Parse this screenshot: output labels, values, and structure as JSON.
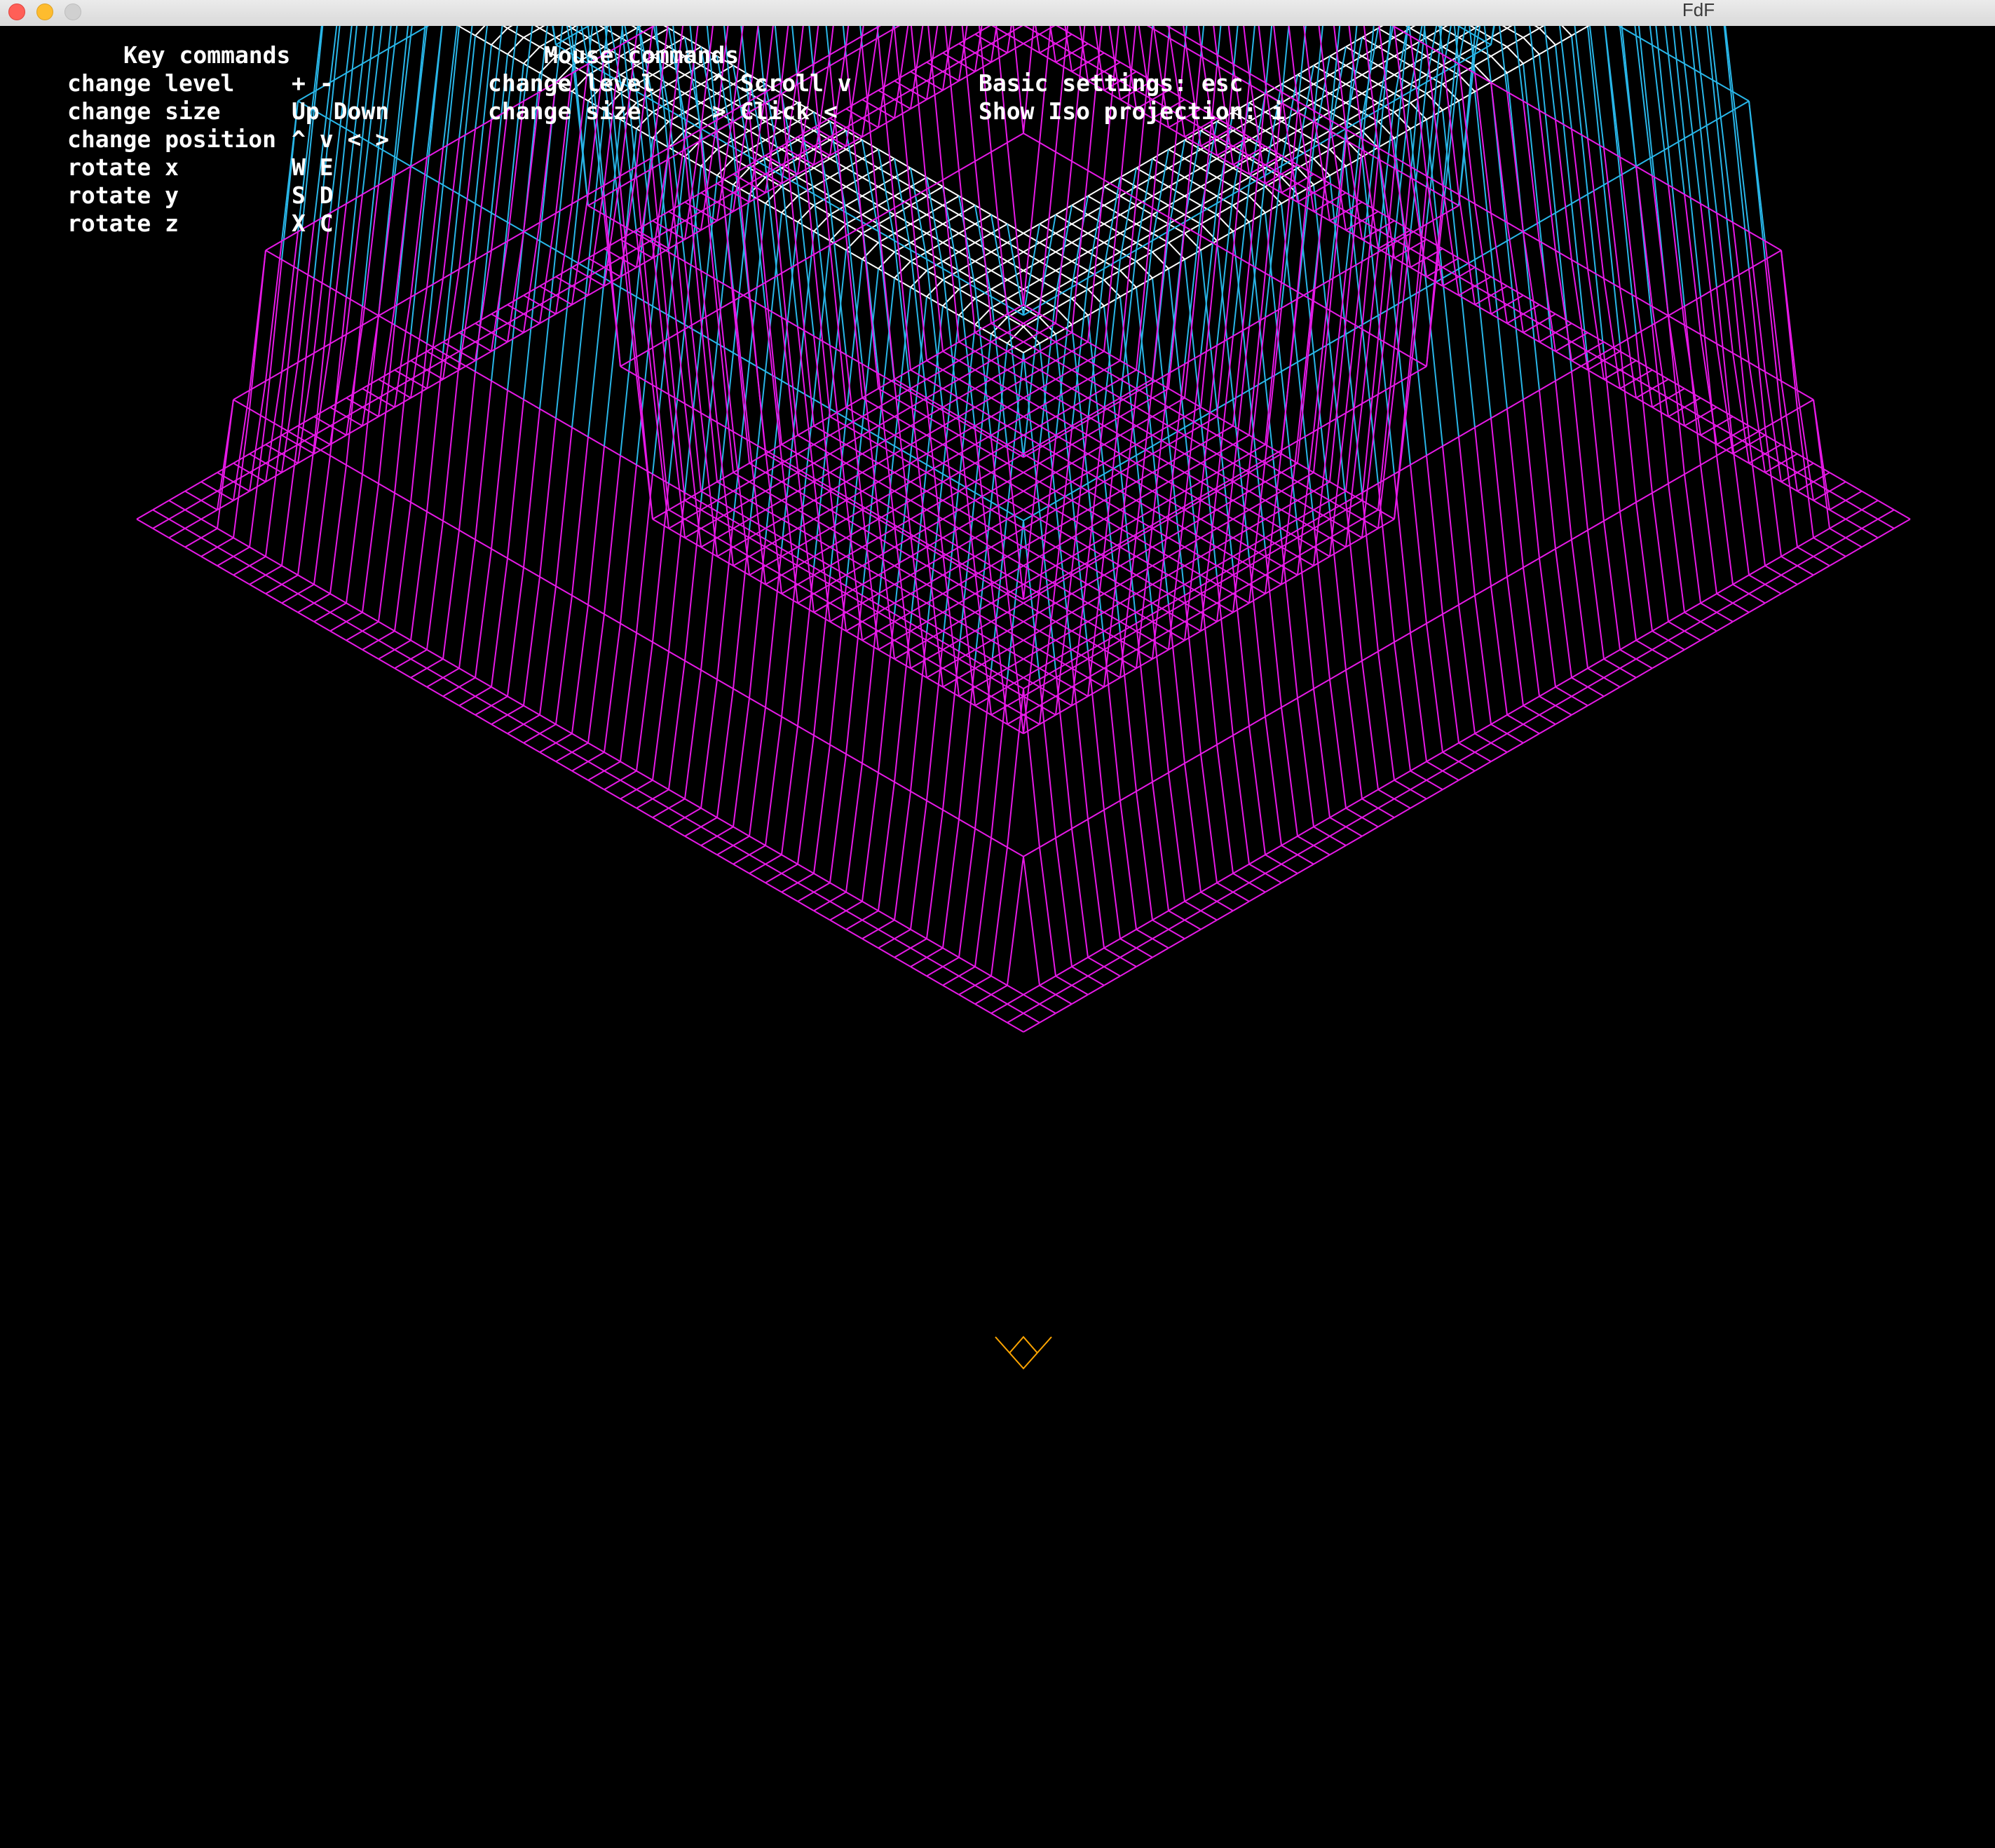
{
  "window": {
    "title": "FdF"
  },
  "key_commands": {
    "header": "Key commands",
    "rows": [
      {
        "action": "change level",
        "keys": "+ -"
      },
      {
        "action": "change size",
        "keys": "Up Down"
      },
      {
        "action": "change position",
        "keys": "^ v < >"
      },
      {
        "action": "rotate x",
        "keys": "W E"
      },
      {
        "action": "rotate y",
        "keys": "S D"
      },
      {
        "action": "rotate z",
        "keys": "X C"
      }
    ]
  },
  "mouse_commands": {
    "header": "Mouse commands",
    "rows": [
      {
        "action": "change level",
        "keys": "^ Scroll v"
      },
      {
        "action": "change size",
        "keys": "> Click <"
      }
    ]
  },
  "settings": {
    "basic": "Basic settings: esc",
    "iso": "Show Iso projection: i"
  },
  "wireframe": {
    "colors": {
      "low": "#e619e6",
      "mid": "#29b6e8",
      "high": "#ffffff",
      "accent": "#ffa500"
    }
  }
}
